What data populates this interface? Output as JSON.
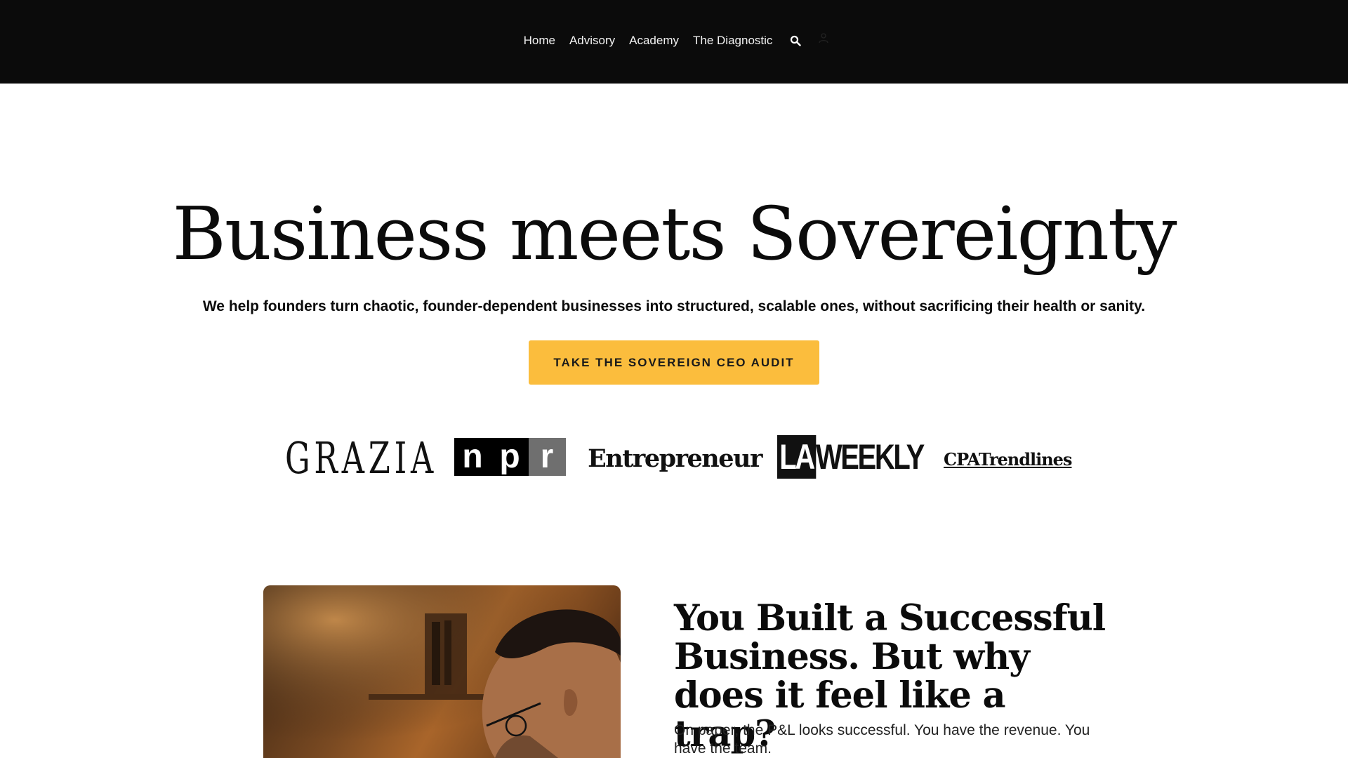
{
  "nav": {
    "links": [
      "Home",
      "Advisory",
      "Academy",
      "The Diagnostic"
    ],
    "icons": [
      "search-icon",
      "user-icon"
    ]
  },
  "hero": {
    "title": "Business meets Sovereignty",
    "subtitle": "We help founders turn chaotic, founder-dependent businesses into structured, scalable ones, without sacrificing their health or sanity.",
    "cta_label": "TAKE THE SOVEREIGN CEO AUDIT"
  },
  "press_logos": {
    "grazia": "GRAZIA",
    "npr": [
      "n",
      "p",
      "r"
    ],
    "entrepreneur": "Entrepreneur",
    "laweekly_la": "LA",
    "laweekly_weekly": "WEEKLY",
    "cpatrendlines": "CPATrendlines"
  },
  "section": {
    "title": "You Built a Successful Business. But why does it feel like a trap?",
    "body": "On paper, the P&L looks successful. You have the revenue. You have the team."
  },
  "colors": {
    "nav_bg": "#0b0b0b",
    "cta_bg": "#fbbd3d",
    "text": "#0b0b0b"
  }
}
